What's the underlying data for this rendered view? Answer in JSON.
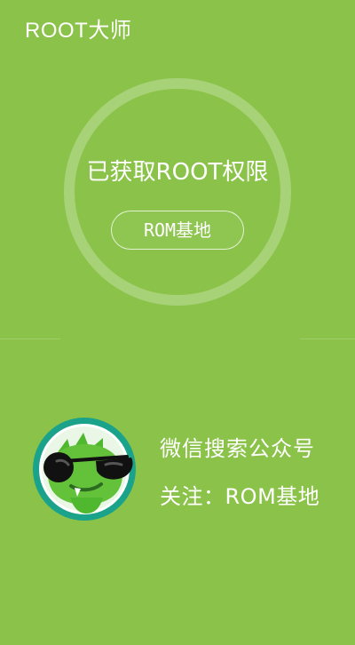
{
  "app": {
    "title": "ROOT大师"
  },
  "status": {
    "message": "已获取ROOT权限",
    "button_label": "ROM基地"
  },
  "promo": {
    "line1": "微信搜索公众号",
    "line2": "关注：ROM基地"
  },
  "colors": {
    "background": "#8bc34a",
    "ring": "rgba(255,255,255,0.25)",
    "text": "#ffffff",
    "avatar_ring": "#1aa38a",
    "mascot_green": "#63c23a"
  },
  "icons": {
    "avatar": "green-pirate-mascot-icon"
  }
}
